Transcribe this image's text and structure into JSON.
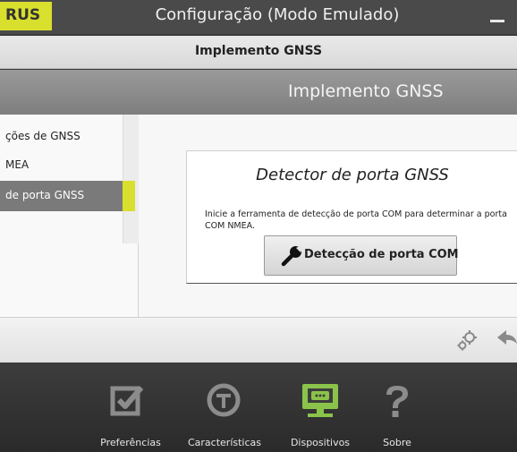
{
  "window": {
    "brand_text": "RUS",
    "title": "Configuração (Modo Emulado)"
  },
  "header": {
    "title": "Implemento GNSS",
    "subtitle": "Implemento GNSS"
  },
  "sidebar": {
    "items": [
      {
        "label": "ções de GNSS"
      },
      {
        "label": "MEA"
      },
      {
        "label": "de porta GNSS"
      }
    ]
  },
  "card": {
    "title": "Detector de porta GNSS",
    "description": "Inicie a ferramenta de detecção de porta COM para determinar a porta COM NMEA.",
    "button_label": "Detecção de porta COM"
  },
  "bottom_nav": {
    "items": [
      {
        "label": "Preferências",
        "icon": "checkbox-icon"
      },
      {
        "label": "Características",
        "icon": "feature-t-icon"
      },
      {
        "label": "Dispositivos",
        "icon": "device-monitor-icon"
      },
      {
        "label": "Sobre",
        "icon": "question-icon"
      }
    ]
  },
  "colors": {
    "accent": "#d8df2c",
    "device_green": "#8bc34a"
  }
}
